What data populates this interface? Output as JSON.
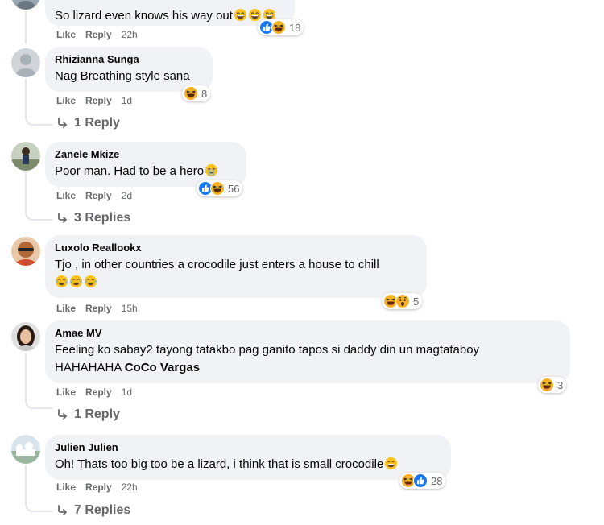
{
  "labels": {
    "like": "Like",
    "reply": "Reply"
  },
  "comments": [
    {
      "text": "So lizard even knows his way out",
      "time": "22h",
      "reaction_count": "18",
      "reactions": [
        "like",
        "haha"
      ],
      "inline_emojis": [
        "laugh-emoji",
        "laugh-emoji",
        "laugh-emoji"
      ]
    },
    {
      "author": "Rhizianna Sunga",
      "text": "Nag Breathing style sana",
      "time": "1d",
      "reaction_count": "8",
      "reactions": [
        "haha"
      ],
      "replies": "1 Reply"
    },
    {
      "author": "Zanele Mkize",
      "text": "Poor man. Had to be a hero",
      "time": "2d",
      "reaction_count": "56",
      "reactions": [
        "like",
        "haha"
      ],
      "inline_emojis": [
        "tears-emoji"
      ],
      "replies": "3 Replies"
    },
    {
      "author": "Luxolo Reallookx",
      "text": "Tjo , in other countries a crocodile just enters a house to chill",
      "time": "15h",
      "reaction_count": "5",
      "reactions": [
        "haha",
        "wow"
      ],
      "inline_emojis": [
        "crying-laugh-emoji",
        "crying-laugh-emoji",
        "crying-laugh-emoji"
      ]
    },
    {
      "author": "Amae MV",
      "text": "Feeling ko sabay2 tayong tatakbo pag ganito tapos si daddy din un magtataboy",
      "text_line2": "HAHAHAHA",
      "mention": "CoCo Vargas",
      "time": "1d",
      "reaction_count": "3",
      "reactions": [
        "haha"
      ],
      "replies": "1 Reply"
    },
    {
      "author": "Julien Julien",
      "text": "Oh! Thats too big too be a lizard, i think that is small crocodile",
      "time": "22h",
      "reaction_count": "28",
      "reactions": [
        "haha",
        "like"
      ],
      "inline_emojis": [
        "laugh-emoji"
      ],
      "replies": "7 Replies"
    }
  ],
  "colors": {
    "bubble": "#f0f2f5",
    "like_blue": "#1877f2",
    "haha_yellow": "#f7b125",
    "meta_gray": "#65676b"
  }
}
